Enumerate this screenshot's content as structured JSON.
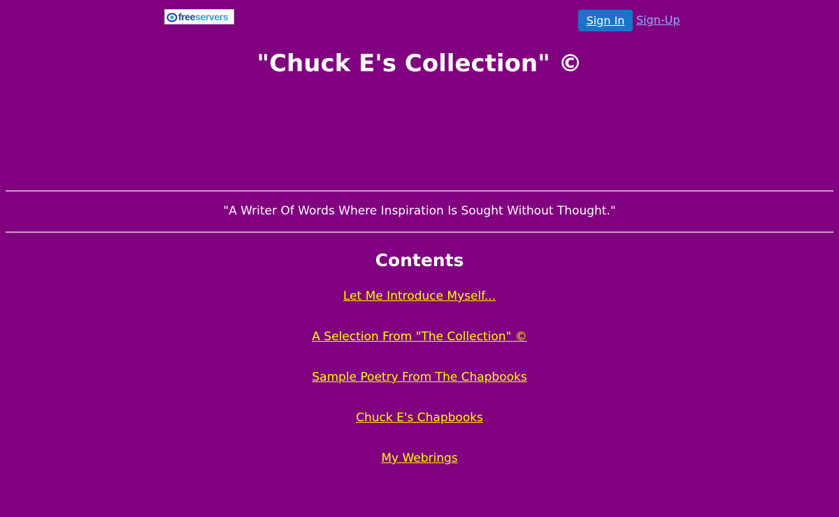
{
  "header": {
    "logo": {
      "icon": "freeservers-eye-icon",
      "text_part1": "free",
      "text_part2": "servers"
    },
    "sign_in_label": "Sign In",
    "sign_up_label": "Sign-Up"
  },
  "page": {
    "title": "\"Chuck E's Collection\" ©",
    "tagline": "\"A Writer Of Words Where Inspiration Is Sought Without Thought.\"",
    "contents_heading": "Contents",
    "links": [
      {
        "label": "Let Me Introduce Myself..."
      },
      {
        "label": "A Selection From \"The Collection\" ©"
      },
      {
        "label": "Sample Poetry From The Chapbooks"
      },
      {
        "label": "Chuck E's Chapbooks"
      },
      {
        "label": "My Webrings"
      }
    ]
  },
  "colors": {
    "background": "#800080",
    "link": "#ffff00",
    "sign_in_button": "#1a73c8",
    "sign_up_link": "#8fb4ff",
    "text": "#ffffff"
  }
}
